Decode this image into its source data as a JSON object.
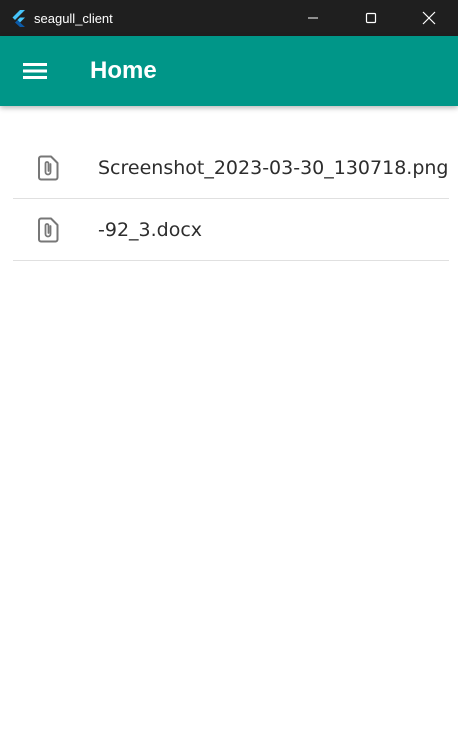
{
  "window": {
    "title": "seagull_client",
    "app_icon": "flutter-logo-icon",
    "controls": [
      "minimize-icon",
      "maximize-icon",
      "close-icon"
    ]
  },
  "appbar": {
    "menu_icon": "hamburger-menu-icon",
    "title": "Home",
    "color": "#009688"
  },
  "files": [
    {
      "name": "Screenshot_2023-03-30_130718.png",
      "icon": "attachment-file-icon"
    },
    {
      "name": "-92_3.docx",
      "icon": "attachment-file-icon"
    }
  ]
}
